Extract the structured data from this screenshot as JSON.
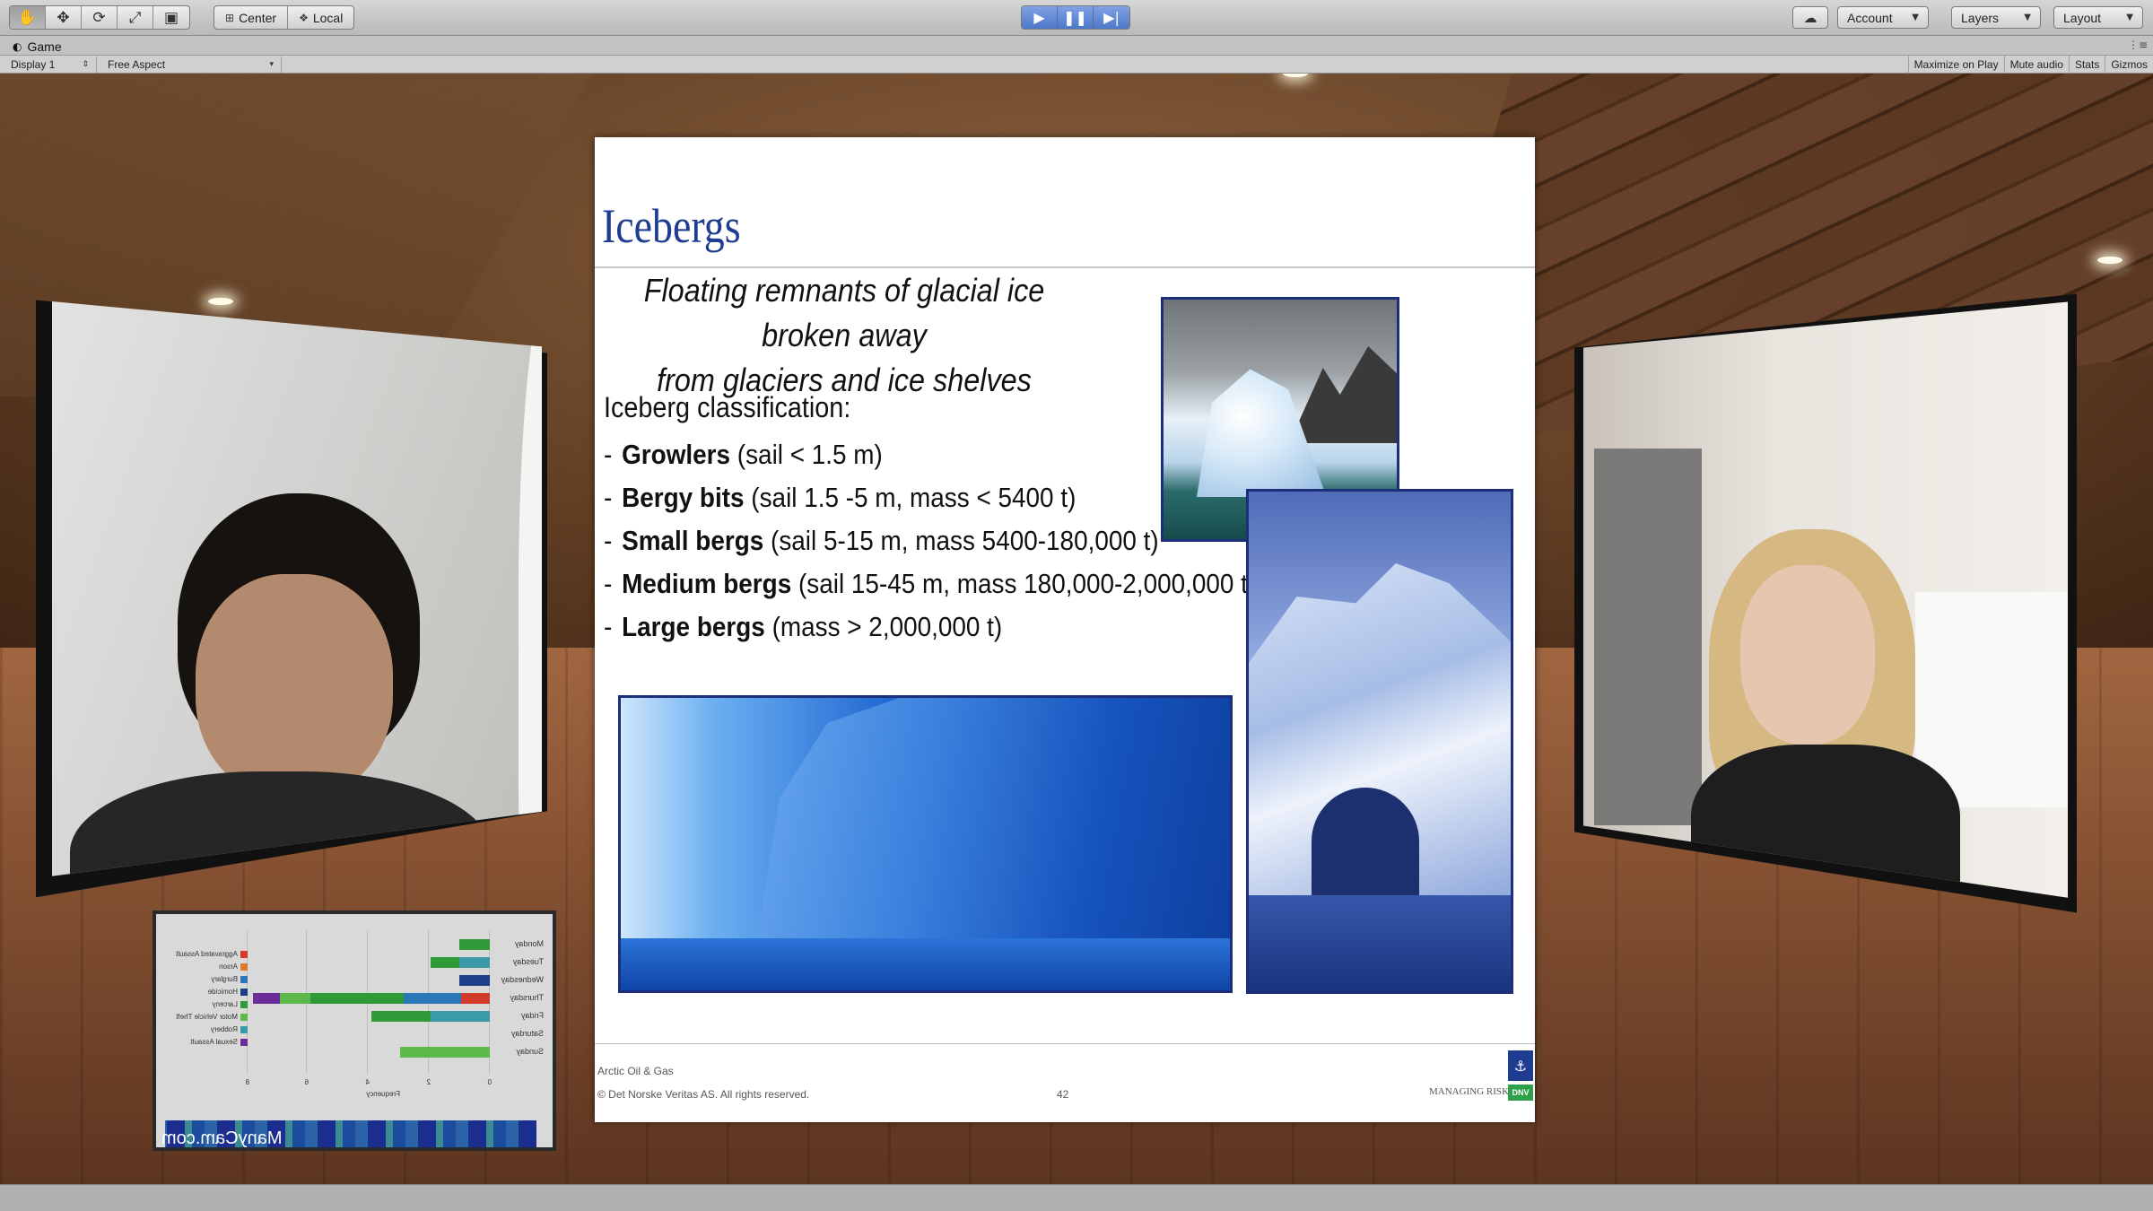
{
  "toolbar": {
    "pivot_center": "Center",
    "pivot_local": "Local",
    "account_label": "Account",
    "layers_label": "Layers",
    "layout_label": "Layout"
  },
  "game_tab": {
    "title": "Game",
    "display": "Display 1",
    "aspect": "Free Aspect",
    "maximize": "Maximize on Play",
    "mute": "Mute audio",
    "stats": "Stats",
    "gizmos": "Gizmos"
  },
  "slide": {
    "title": "Icebergs",
    "subtitle_line1": "Floating remnants of glacial ice broken away",
    "subtitle_line2": "from glaciers and ice shelves",
    "classification_heading": "Iceberg classification:",
    "bullets": [
      {
        "name": "Growlers",
        "detail": "(sail < 1.5 m)"
      },
      {
        "name": "Bergy bits",
        "detail": "(sail 1.5 -5 m, mass < 5400 t)"
      },
      {
        "name": "Small bergs",
        "detail": "(sail 5-15 m, mass 5400-180,000 t)"
      },
      {
        "name": "Medium bergs",
        "detail": "(sail 15-45 m, mass 180,000-2,000,000 t)"
      },
      {
        "name": "Large bergs",
        "detail": "(mass > 2,000,000 t)"
      }
    ],
    "footer_course": "Arctic Oil & Gas",
    "footer_copyright": "© Det Norske Veritas AS. All rights reserved.",
    "page_number": "42",
    "managing_risk": "MANAGING RISK",
    "logo_text": "DNV"
  },
  "monitor": {
    "days": [
      "Monday",
      "Tuesday",
      "Wednesday",
      "Thursday",
      "Friday",
      "Saturday",
      "Sunday"
    ],
    "legend": [
      {
        "label": "Aggravated Assault",
        "color": "#d23a2a"
      },
      {
        "label": "Arson",
        "color": "#e07a2a"
      },
      {
        "label": "Burglary",
        "color": "#2a78b8"
      },
      {
        "label": "Homicide",
        "color": "#1d3f8a"
      },
      {
        "label": "Larceny",
        "color": "#2e9a3a"
      },
      {
        "label": "Motor Vehicle Theft",
        "color": "#5cb84a"
      },
      {
        "label": "Robbery",
        "color": "#3b9aa8"
      },
      {
        "label": "Sexual Assault",
        "color": "#6a2d9a"
      }
    ],
    "x_axis_label": "Frequency",
    "ticks": [
      "0",
      "2",
      "4",
      "6",
      "8"
    ],
    "watermark": "ManyCam.com"
  }
}
